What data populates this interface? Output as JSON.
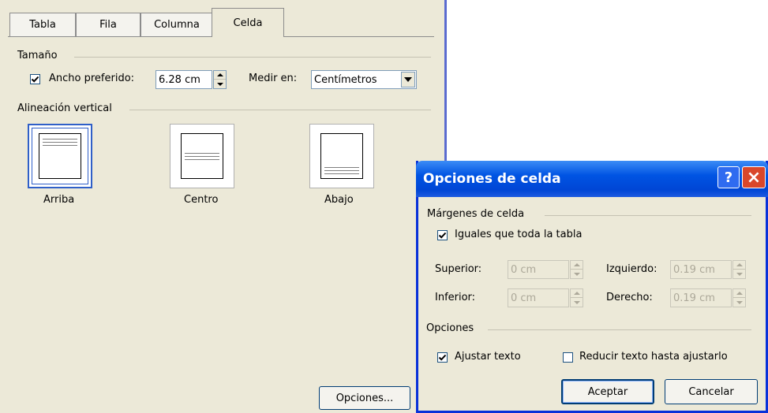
{
  "tabs": [
    {
      "label": "Tabla"
    },
    {
      "label": "Fila"
    },
    {
      "label": "Columna"
    },
    {
      "label": "Celda",
      "active": true
    }
  ],
  "size_group": {
    "label": "Tamaño",
    "preferred_width_checked": true,
    "preferred_width_label": "Ancho preferido:",
    "preferred_width_value": "6.28 cm",
    "measure_in_label": "Medir en:",
    "measure_in_value": "Centímetros"
  },
  "vertical_alignment": {
    "label": "Alineación vertical",
    "options": [
      {
        "label": "Arriba",
        "selected": true
      },
      {
        "label": "Centro",
        "selected": false
      },
      {
        "label": "Abajo",
        "selected": false
      }
    ]
  },
  "options_button": {
    "label": "Opciones..."
  },
  "dialog": {
    "title": "Opciones de celda",
    "help_glyph": "?",
    "close_glyph": "×",
    "margins_group": {
      "label": "Márgenes de celda",
      "same_as_table_checked": true,
      "same_as_table_label": "Iguales que toda la tabla",
      "top_label": "Superior:",
      "top_value": "0 cm",
      "left_label": "Izquierdo:",
      "left_value": "0.19 cm",
      "bottom_label": "Inferior:",
      "bottom_value": "0 cm",
      "right_label": "Derecho:",
      "right_value": "0.19 cm"
    },
    "options_group": {
      "label": "Opciones",
      "wrap_text_checked": true,
      "wrap_text_label": "Ajustar texto",
      "fit_text_checked": false,
      "fit_text_label": "Reducir texto hasta ajustarlo"
    },
    "ok_label": "Aceptar",
    "cancel_label": "Cancelar"
  },
  "colors": {
    "dialog_face": "#ece9d8",
    "title_bar": "#0054e3",
    "selection_border": "#2f5fc8",
    "close_button": "#d9472b"
  }
}
